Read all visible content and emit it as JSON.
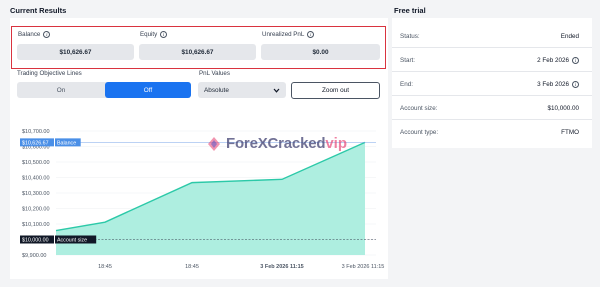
{
  "current_results": {
    "title": "Current Results",
    "stats": [
      {
        "label": "Balance",
        "value": "$10,626.67"
      },
      {
        "label": "Equity",
        "value": "$10,626.67"
      },
      {
        "label": "Unrealized PnL",
        "value": "$0.00"
      }
    ],
    "objective_lines": {
      "label": "Trading Objective Lines",
      "on_label": "On",
      "off_label": "Off",
      "selected": "Off"
    },
    "pnl_values": {
      "label": "PnL Values",
      "selected": "Absolute"
    },
    "zoom_out_label": "Zoom out",
    "colors": {
      "accent": "#1a73f0",
      "area_fill": "#aeeee0",
      "line": "#2cc9a8",
      "highlight_border": "#d9333f"
    }
  },
  "chart_data": {
    "type": "area",
    "y_ticks": [
      "$10,700.00",
      "$10,600.00",
      "$10,500.00",
      "$10,400.00",
      "$10,300.00",
      "$10,200.00",
      "$10,100.00",
      "$10,000.00",
      "$9,900.00"
    ],
    "x_ticks": [
      "18:45",
      "18:45",
      "3 Feb 2026 11:15",
      "3 Feb 2026 11:15"
    ],
    "ylim": [
      9900,
      10700
    ],
    "values": [
      10058,
      10112,
      10212,
      10367,
      10388,
      10626.67
    ],
    "reference_lines": [
      {
        "name": "Balance",
        "value": 10626.67,
        "label_value": "$10,626.67"
      },
      {
        "name": "Account size",
        "value": 10000,
        "label_value": "$10,000.00"
      }
    ],
    "grid": true
  },
  "watermark": {
    "main": "ForeXCracked",
    "suffix": "vip"
  },
  "free_trial": {
    "title": "Free trial",
    "rows": [
      {
        "key": "Status:",
        "value": "Ended"
      },
      {
        "key": "Start:",
        "value": "2 Feb 2026",
        "icon": "info-icon"
      },
      {
        "key": "End:",
        "value": "3 Feb 2026",
        "icon": "info-icon"
      },
      {
        "key": "Account size:",
        "value": "$10,000.00"
      },
      {
        "key": "Account type:",
        "value": "FTMO"
      }
    ]
  }
}
